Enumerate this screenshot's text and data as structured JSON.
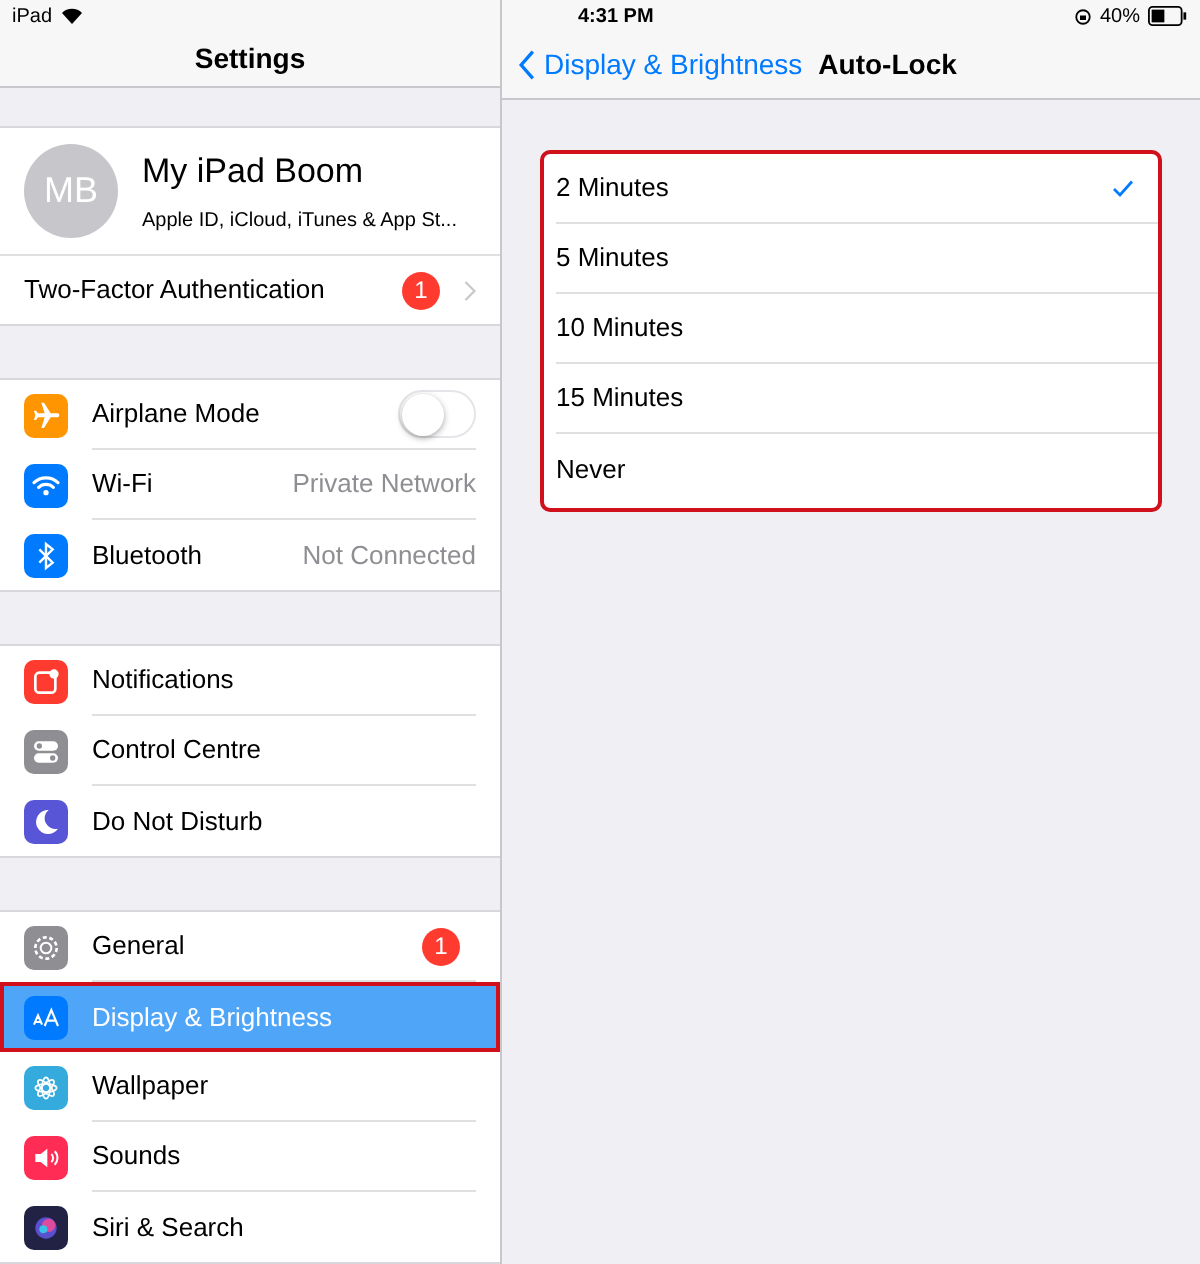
{
  "status_bar": {
    "device": "iPad",
    "time": "4:31 PM",
    "battery": "40%"
  },
  "sidebar": {
    "title": "Settings",
    "profile": {
      "initials": "MB",
      "name": "My iPad Boom",
      "subtitle": "Apple ID, iCloud, iTunes & App St..."
    },
    "two_factor": {
      "label": "Two-Factor Authentication",
      "badge": "1"
    },
    "groups": [
      {
        "items": [
          {
            "label": "Airplane Mode",
            "kind": "toggle",
            "on": false,
            "selected": false,
            "outlined": false,
            "color": "#ff9500"
          },
          {
            "label": "Wi-Fi",
            "kind": "value",
            "value": "Private Network",
            "selected": false,
            "outlined": false,
            "color": "#007aff"
          },
          {
            "label": "Bluetooth",
            "kind": "value",
            "value": "Not Connected",
            "selected": false,
            "outlined": false,
            "color": "#007aff"
          }
        ]
      },
      {
        "items": [
          {
            "label": "Notifications",
            "kind": "plain",
            "selected": false,
            "outlined": false,
            "color": "#ff3b30"
          },
          {
            "label": "Control Centre",
            "kind": "plain",
            "selected": false,
            "outlined": false,
            "color": "#8e8e93"
          },
          {
            "label": "Do Not Disturb",
            "kind": "plain",
            "selected": false,
            "outlined": false,
            "color": "#5856d6"
          }
        ]
      },
      {
        "items": [
          {
            "label": "General",
            "kind": "badge",
            "badge": "1",
            "selected": false,
            "outlined": false,
            "color": "#8e8e93"
          },
          {
            "label": "Display & Brightness",
            "kind": "plain",
            "selected": true,
            "outlined": true,
            "color": "#007aff"
          },
          {
            "label": "Wallpaper",
            "kind": "plain",
            "selected": false,
            "outlined": false,
            "color": "#35aadc"
          },
          {
            "label": "Sounds",
            "kind": "plain",
            "selected": false,
            "outlined": false,
            "color": "#ff2d55"
          },
          {
            "label": "Siri & Search",
            "kind": "plain",
            "selected": false,
            "outlined": false,
            "color": "#222244"
          }
        ]
      }
    ]
  },
  "detail": {
    "back": "Display & Brightness",
    "title": "Auto-Lock",
    "outlined": true,
    "options": [
      {
        "label": "2 Minutes",
        "selected": true
      },
      {
        "label": "5 Minutes",
        "selected": false
      },
      {
        "label": "10 Minutes",
        "selected": false
      },
      {
        "label": "15 Minutes",
        "selected": false
      },
      {
        "label": "Never",
        "selected": false
      }
    ]
  }
}
